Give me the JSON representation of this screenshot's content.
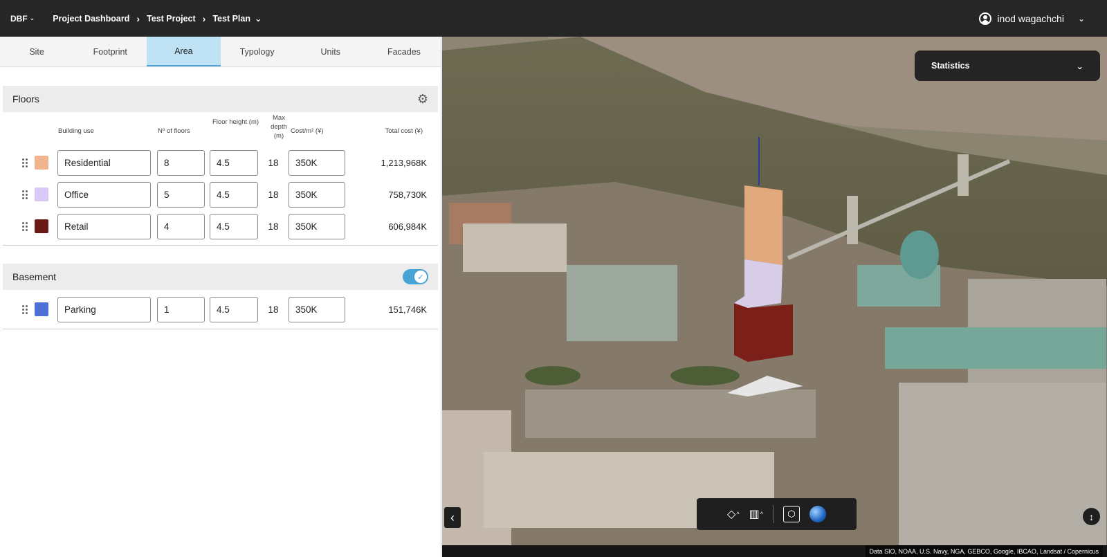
{
  "header": {
    "brand": "DBF",
    "breadcrumbs": [
      "Project Dashboard",
      "Test Project",
      "Test Plan"
    ],
    "user_name": "inod wagachchi"
  },
  "tabs": [
    "Site",
    "Footprint",
    "Area",
    "Typology",
    "Units",
    "Facades"
  ],
  "active_tab": "Area",
  "floors": {
    "title": "Floors",
    "columns": {
      "use": "Building use",
      "floors": "Nº of floors",
      "height": "Floor height (m)",
      "depth": "Max depth (m)",
      "cost": "Cost/m² (¥)",
      "total": "Total cost (¥)"
    },
    "rows": [
      {
        "use": "Residential",
        "floors": "8",
        "height": "4.5",
        "depth": "18",
        "cost": "350K",
        "total": "1,213,968K",
        "color": "#f0b48e"
      },
      {
        "use": "Office",
        "floors": "5",
        "height": "4.5",
        "depth": "18",
        "cost": "350K",
        "total": "758,730K",
        "color": "#d9c8f5"
      },
      {
        "use": "Retail",
        "floors": "4",
        "height": "4.5",
        "depth": "18",
        "cost": "350K",
        "total": "606,984K",
        "color": "#6e1a14"
      }
    ]
  },
  "basement": {
    "title": "Basement",
    "enabled": true,
    "rows": [
      {
        "use": "Parking",
        "floors": "1",
        "height": "4.5",
        "depth": "18",
        "cost": "350K",
        "total": "151,746K",
        "color": "#4c6fd8"
      }
    ]
  },
  "map": {
    "stats_label": "Statistics",
    "attribution": "Data SIO, NOAA, U.S. Navy, NGA, GEBCO, Google, IBCAO, Landsat / Copernicus"
  },
  "colors": {
    "accent": "#4aa3d6",
    "topbar": "#262626"
  }
}
